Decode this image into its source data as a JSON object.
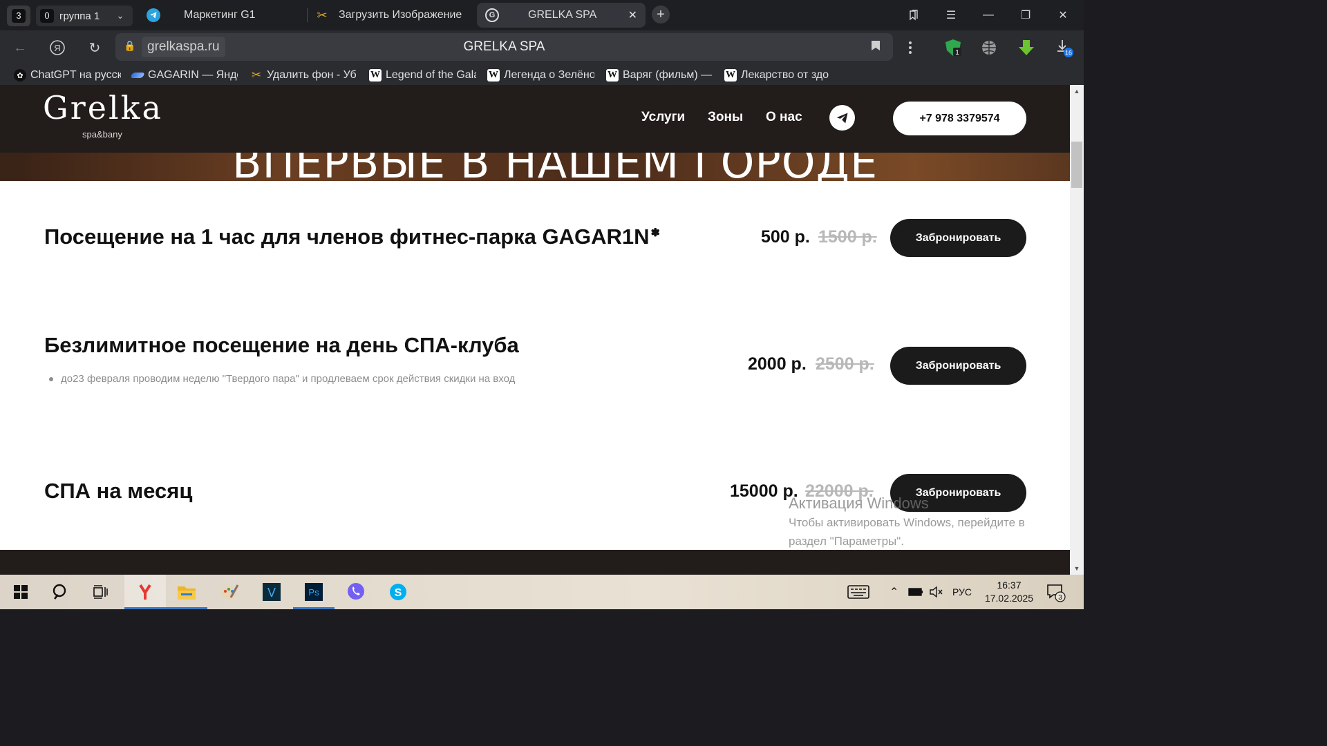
{
  "browser": {
    "tab_counter": "3",
    "group": {
      "count": "0",
      "label": "группа 1"
    },
    "tabs": [
      {
        "label": "Маркетинг G1",
        "icon": "telegram-icon"
      },
      {
        "label": "Загрузить Изображение",
        "icon": "scissors-icon"
      },
      {
        "label": "GRELKA SPA",
        "icon": "grelka-favicon",
        "active": true
      }
    ],
    "address": {
      "domain": "grelkaspa.ru",
      "title": "GRELKA SPA"
    },
    "extensions": {
      "shield_badge": "1",
      "downloads_badge": "16"
    },
    "bookmarks": [
      {
        "label": "ChatGPT на русск",
        "icon": "chatgpt-icon"
      },
      {
        "label": "GAGARIN — Янде",
        "icon": "gagarin-icon"
      },
      {
        "label": "Удалить фон - Убр",
        "icon": "scissors-icon"
      },
      {
        "label": "Legend of the Gala",
        "icon": "wikipedia-icon"
      },
      {
        "label": "Легенда о Зелёно",
        "icon": "wikipedia-icon"
      },
      {
        "label": "Варяг (фильм) —",
        "icon": "wikipedia-icon"
      },
      {
        "label": "Лекарство от здо",
        "icon": "wikipedia-icon"
      }
    ]
  },
  "site": {
    "logo": {
      "main": "Grelka",
      "sub": "spa&bany"
    },
    "nav": [
      "Услуги",
      "Зоны",
      "О нас"
    ],
    "phone": "+7 978 3379574",
    "hero_text": "ВПЕРВЫЕ В НАШЕМ ГОРОДЕ",
    "services": [
      {
        "title": "Посещение на 1 час для членов фитнес-парка GAGAR1N",
        "title_mark": "✽",
        "note": "",
        "price": "500 р.",
        "old_price": "1500 р.",
        "button": "Забронировать"
      },
      {
        "title": "Безлимитное посещение на день СПА-клуба",
        "title_mark": "",
        "note": "до23 февраля проводим неделю \"Твердого пара\" и продлеваем срок действия скидки на вход",
        "price": "2000 р.",
        "old_price": "2500 р.",
        "button": "Забронировать"
      },
      {
        "title": "СПА на месяц",
        "title_mark": "",
        "note": "",
        "price": "15000 р.",
        "old_price": "22000 р.",
        "button": "Забронировать"
      }
    ]
  },
  "windows": {
    "activation_title": "Активация Windows",
    "activation_text_1": "Чтобы активировать Windows, перейдите в",
    "activation_text_2": "раздел \"Параметры\".",
    "language": "РУС",
    "time": "16:37",
    "date": "17.02.2025",
    "notifications": "3"
  },
  "colors": {
    "header_bg": "#221c1b",
    "button_bg": "#1b1b1b",
    "old_price": "#b8b8b8"
  }
}
